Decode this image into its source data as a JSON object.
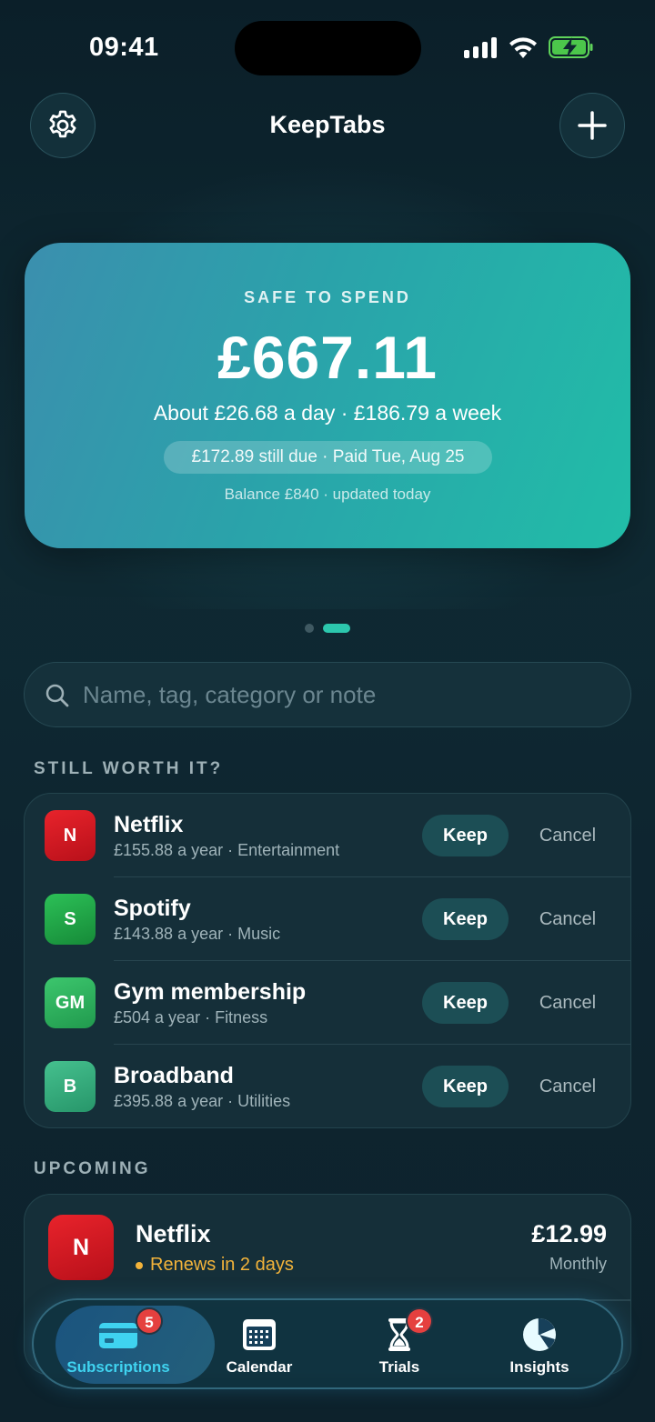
{
  "status_bar": {
    "time": "09:41"
  },
  "header": {
    "title": "KeepTabs"
  },
  "hero": {
    "label": "SAFE TO SPEND",
    "amount": "£667.11",
    "subtitle": "About £26.68 a day · £186.79 a week",
    "pill": "£172.89 still due · Paid Tue, Aug 25",
    "balance": "Balance £840 · updated today"
  },
  "pager": {
    "count": 2,
    "active_index": 1
  },
  "search": {
    "placeholder": "Name, tag, category or note",
    "value": ""
  },
  "worth_it": {
    "title": "STILL WORTH IT?",
    "keep_label": "Keep",
    "cancel_label": "Cancel",
    "items": [
      {
        "initials": "N",
        "name": "Netflix",
        "meta": "£155.88 a year · Entertainment",
        "color": "#d51a22"
      },
      {
        "initials": "S",
        "name": "Spotify",
        "meta": "£143.88 a year · Music",
        "color": "#20a548"
      },
      {
        "initials": "GM",
        "name": "Gym membership",
        "meta": "£504 a year · Fitness",
        "color": "#2fb35f"
      },
      {
        "initials": "B",
        "name": "Broadband",
        "meta": "£395.88 a year · Utilities",
        "color": "#35b07f"
      }
    ]
  },
  "upcoming": {
    "title": "UPCOMING",
    "items": [
      {
        "initials": "N",
        "name": "Netflix",
        "renew": "Renews in 2 days",
        "price": "£12.99",
        "cycle": "Monthly"
      }
    ]
  },
  "tabs": [
    {
      "label": "Subscriptions",
      "icon": "card-icon",
      "badge": "5",
      "active": true
    },
    {
      "label": "Calendar",
      "icon": "calendar-icon",
      "badge": "",
      "active": false
    },
    {
      "label": "Trials",
      "icon": "hourglass-icon",
      "badge": "2",
      "active": false
    },
    {
      "label": "Insights",
      "icon": "pie-chart-icon",
      "badge": "",
      "active": false
    }
  ],
  "colors": {
    "accent": "#2cc7ad",
    "tab_active": "#3fd3f0",
    "warning": "#f2b33a",
    "badge": "#e5403f"
  }
}
